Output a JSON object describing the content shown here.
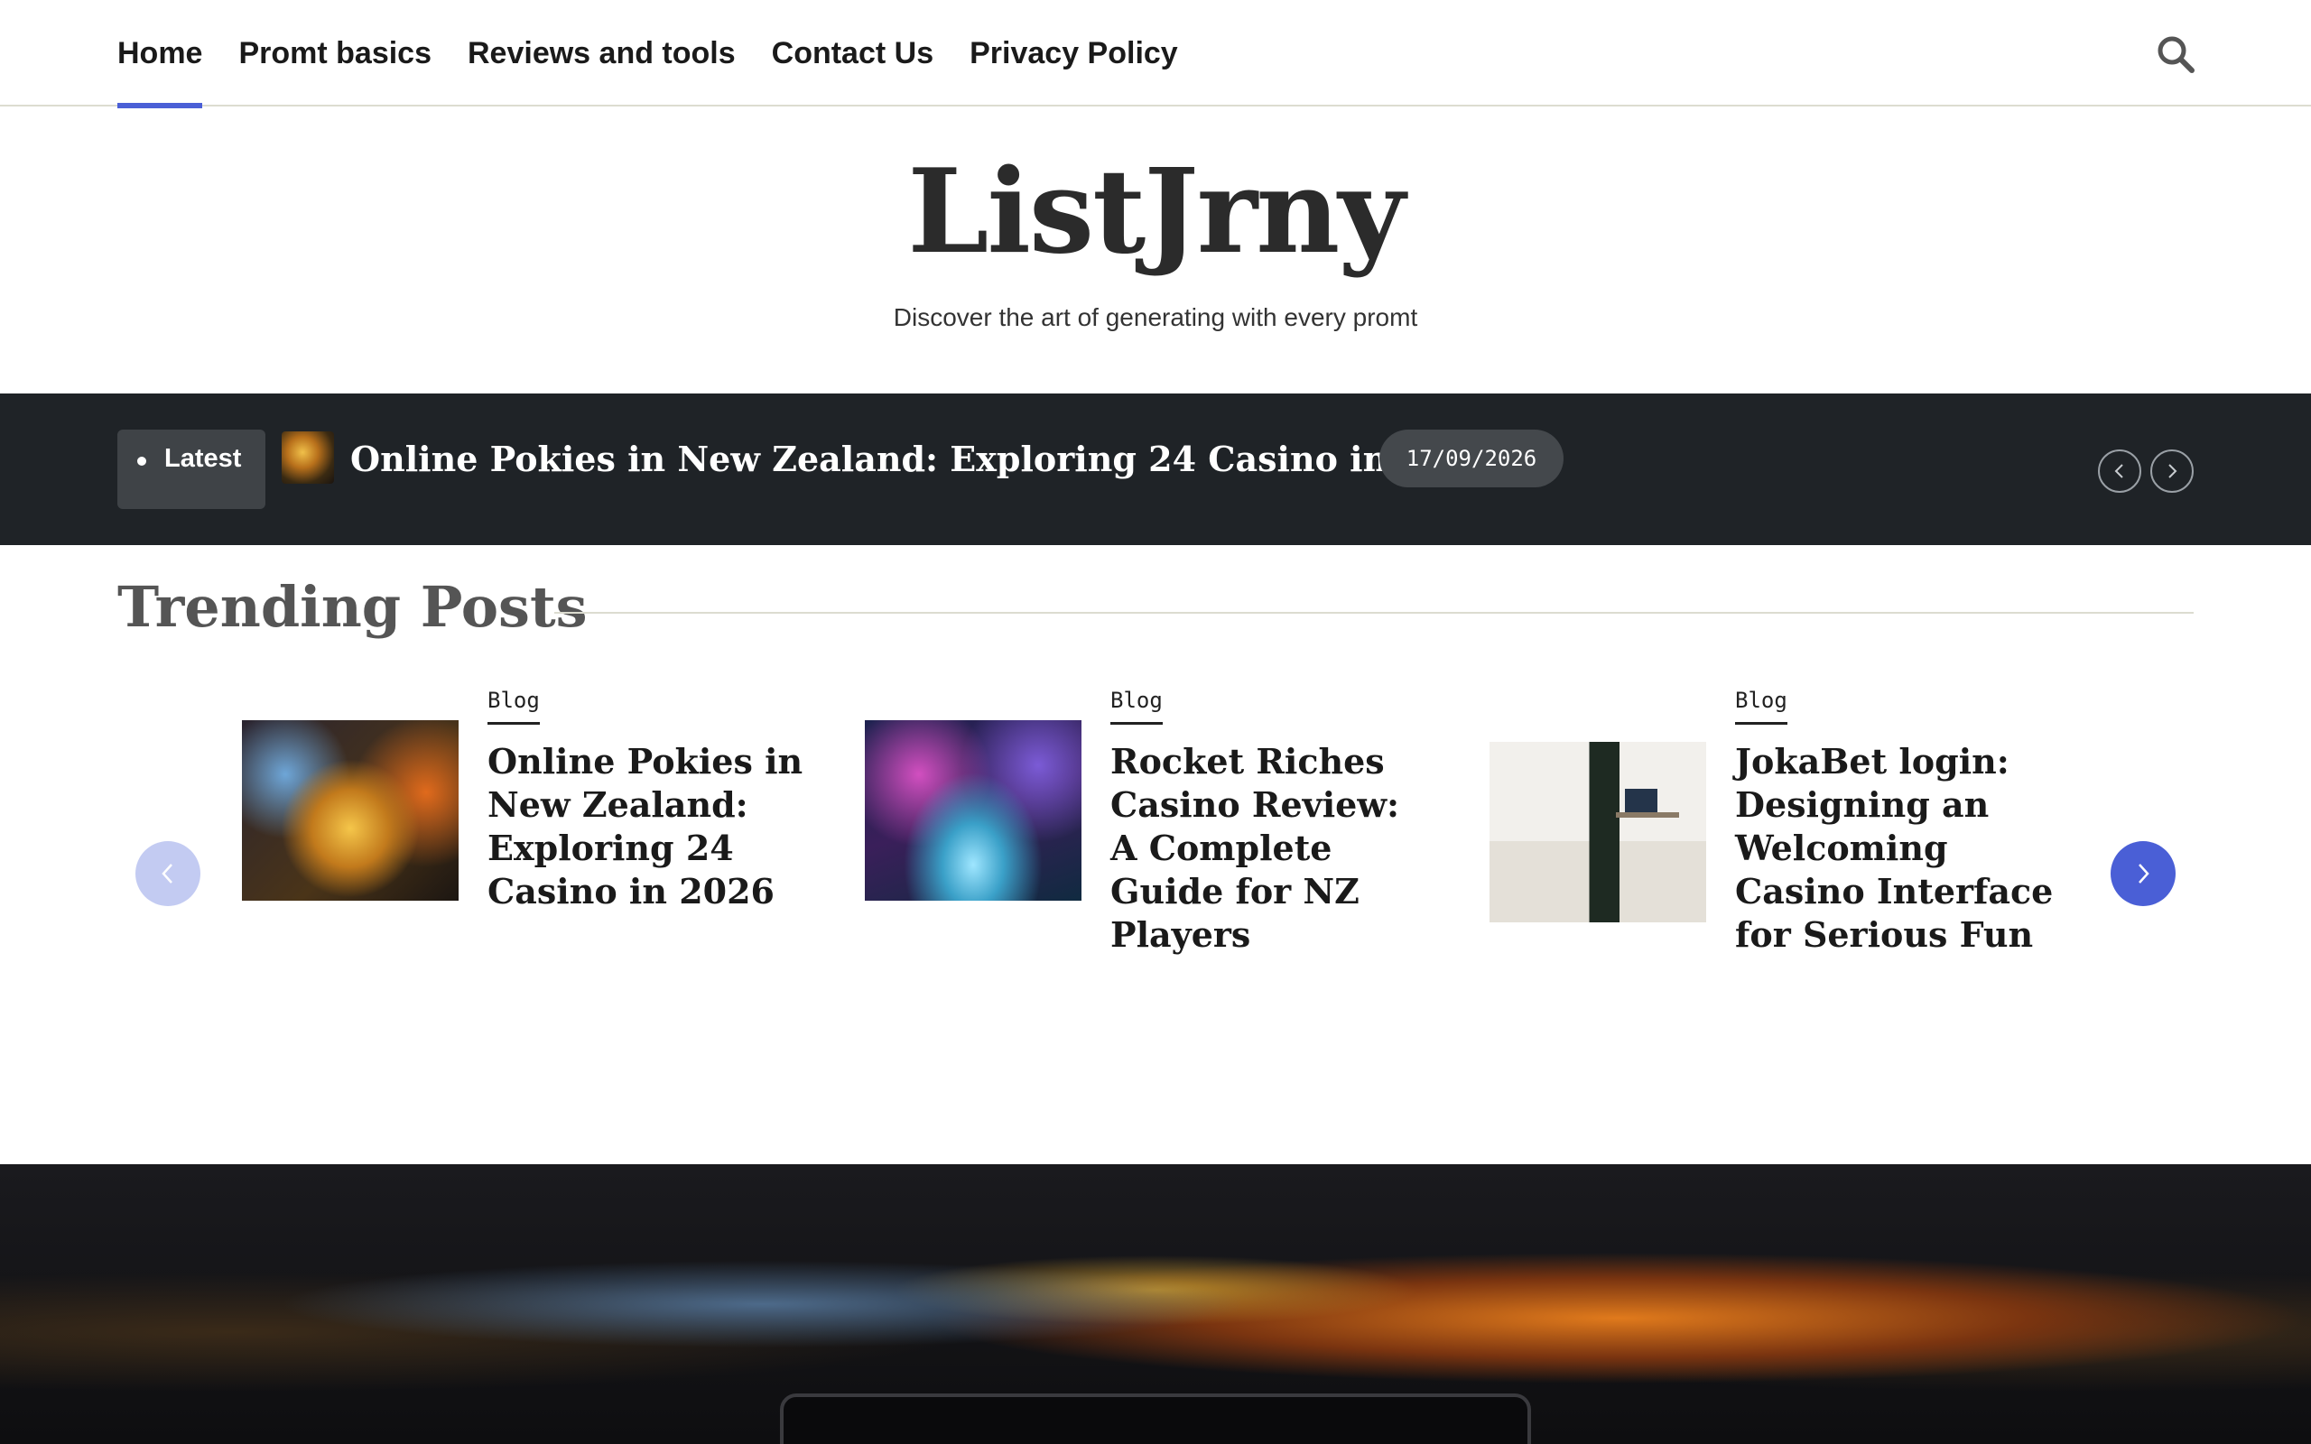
{
  "nav": {
    "items": [
      {
        "label": "Home",
        "active": true
      },
      {
        "label": "Promt basics",
        "active": false
      },
      {
        "label": "Reviews and tools",
        "active": false
      },
      {
        "label": "Contact Us",
        "active": false
      },
      {
        "label": "Privacy Policy",
        "active": false
      }
    ],
    "search_icon": "search-icon"
  },
  "header": {
    "site_title": "ListJrny",
    "tagline": "Discover the art of generating with every promt"
  },
  "ticker": {
    "badge": "Latest",
    "title": "Online Pokies in New Zealand: Exploring 24 Casino in 2026",
    "date": "17/09/2026"
  },
  "trending": {
    "heading": "Trending Posts",
    "posts": [
      {
        "category": "Blog",
        "title": "Online Pokies in New Zealand: Exploring 24 Casino in 2026"
      },
      {
        "category": "Blog",
        "title": "Rocket Riches Casino Review: A Complete Guide for NZ Players"
      },
      {
        "category": "Blog",
        "title": "JokaBet login: Designing an Welcoming Casino Interface for Serious Fun"
      }
    ]
  },
  "colors": {
    "accent": "#4a5fd6",
    "ticker_bg": "#1f2327",
    "badge_bg": "#3f4347"
  }
}
